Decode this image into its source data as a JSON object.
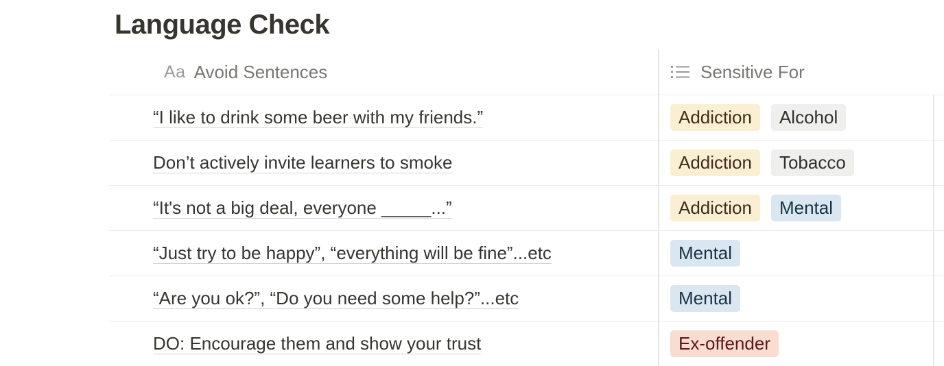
{
  "page": {
    "title": "Language Check"
  },
  "table": {
    "columns": [
      {
        "label": "Avoid Sentences",
        "icon": "text-aa-icon",
        "icon_text": "Aa"
      },
      {
        "label": "Sensitive For",
        "icon": "list-icon"
      }
    ],
    "rows": [
      {
        "sentence": "“I like to drink some beer with my friends.”",
        "tags": [
          {
            "label": "Addiction",
            "bg": "#fbefd3",
            "fg": "#402c1b"
          },
          {
            "label": "Alcohol",
            "bg": "#efefed",
            "fg": "#32302c"
          }
        ]
      },
      {
        "sentence": "Don’t actively invite learners to smoke",
        "tags": [
          {
            "label": "Addiction",
            "bg": "#fbefd3",
            "fg": "#402c1b"
          },
          {
            "label": "Tobacco",
            "bg": "#efefed",
            "fg": "#32302c"
          }
        ]
      },
      {
        "sentence": "“It's not a big deal, everyone _____...”",
        "tags": [
          {
            "label": "Addiction",
            "bg": "#fbefd3",
            "fg": "#402c1b"
          },
          {
            "label": "Mental",
            "bg": "#dbe7f0",
            "fg": "#183347"
          }
        ]
      },
      {
        "sentence": "“Just try to be happy”, “everything will be fine”...etc",
        "tags": [
          {
            "label": "Mental",
            "bg": "#dbe7f0",
            "fg": "#183347"
          }
        ]
      },
      {
        "sentence": "“Are you ok?”, “Do you need some help?”...etc",
        "tags": [
          {
            "label": "Mental",
            "bg": "#dbe7f0",
            "fg": "#183347"
          }
        ]
      },
      {
        "sentence": "DO: Encourage them and show your trust",
        "tags": [
          {
            "label": "Ex-offender",
            "bg": "#f8ddd0",
            "fg": "#5d1715"
          }
        ]
      }
    ]
  }
}
